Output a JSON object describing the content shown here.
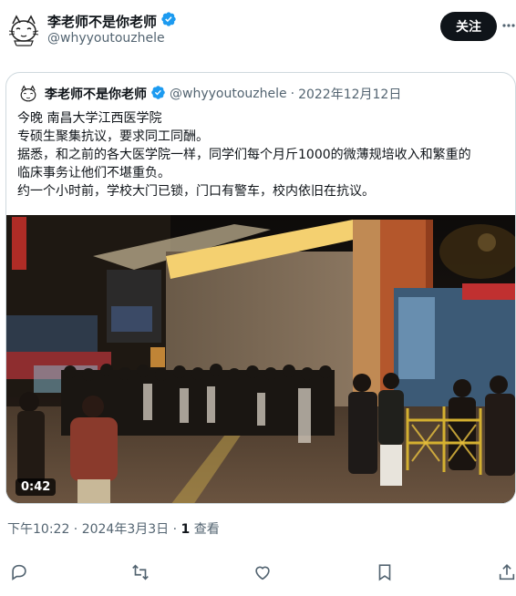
{
  "author": {
    "name": "李老师不是你老师",
    "handle": "@whyyoutouzhele"
  },
  "follow_label": "关注",
  "quoted": {
    "name": "李老师不是你老师",
    "handle": "@whyyoutouzhele",
    "separator": "·",
    "date": "2022年12月12日",
    "lines": [
      "今晚 南昌大学江西医学院",
      "专硕生聚集抗议，要求同工同酬。",
      "据悉，和之前的各大医学院一样，同学们每个月斤1000的微薄规培收入和繁重的",
      "临床事务让他们不堪重负。",
      "约一个小时前，学校大门已锁，门口有警车，校内依旧在抗议。"
    ],
    "video": {
      "duration": "0:42"
    }
  },
  "meta": {
    "time": "下午10:22 · 2024年3月3日 · ",
    "views_count": "1",
    "views_label": " 查看"
  },
  "actions": [
    {
      "icon": "reply-icon"
    },
    {
      "icon": "retweet-icon"
    },
    {
      "icon": "like-icon"
    },
    {
      "icon": "bookmark-icon"
    },
    {
      "icon": "share-icon"
    }
  ],
  "colors": {
    "text": "#0f1419",
    "muted": "#536471",
    "verified": "#1d9bf0",
    "border": "#cfd9de"
  }
}
